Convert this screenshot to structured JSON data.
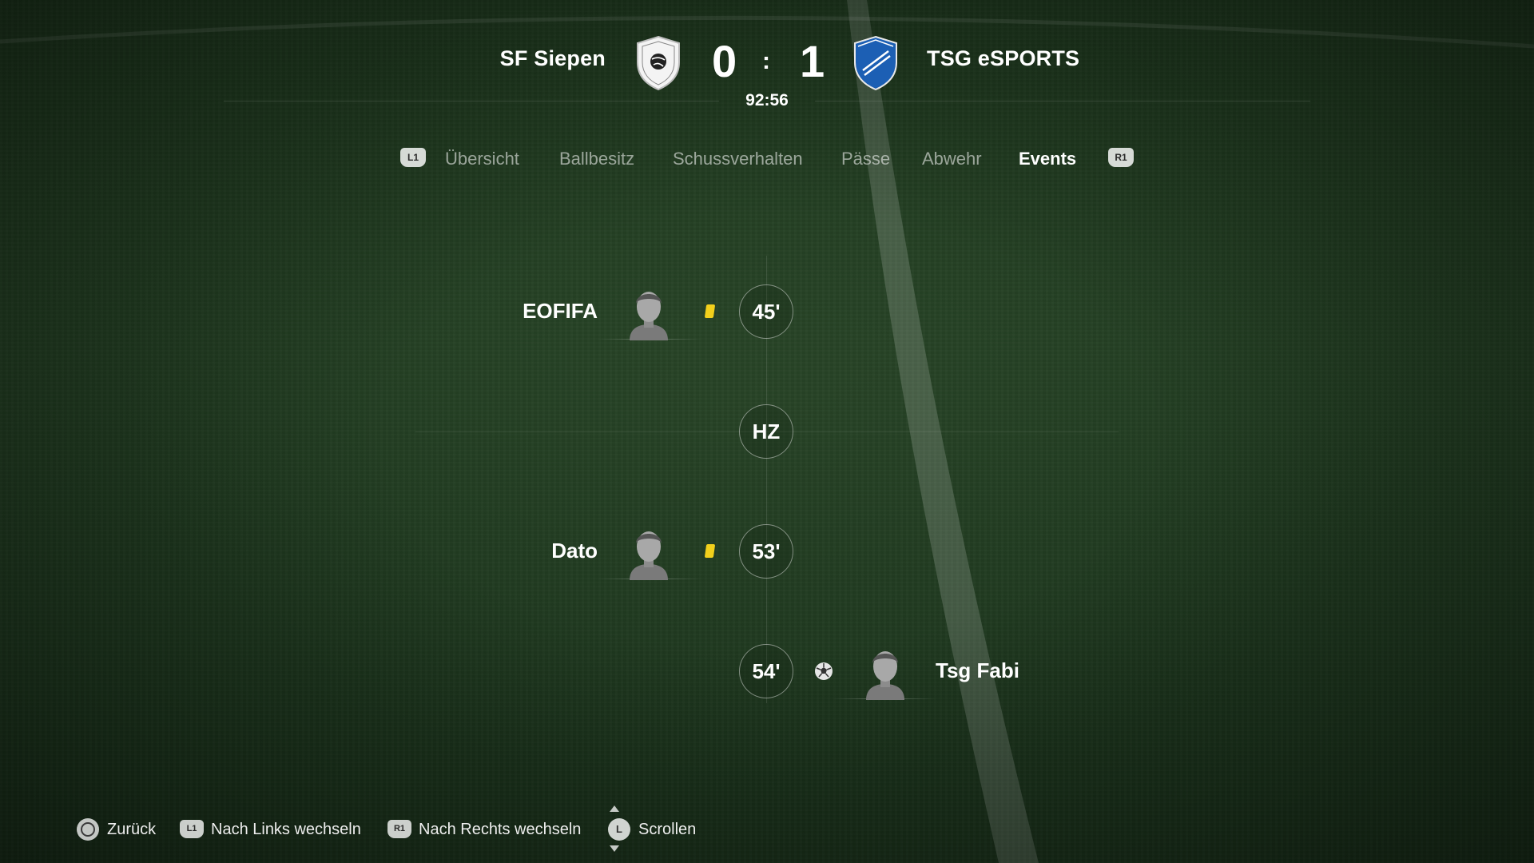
{
  "match": {
    "home_team": "SF Siepen",
    "away_team": "TSG eSPORTS",
    "home_score": "0",
    "away_score": "1",
    "separator": ":",
    "clock": "92:56"
  },
  "tabs": {
    "left_button": "L1",
    "right_button": "R1",
    "items": [
      "Übersicht",
      "Ballbesitz",
      "Schussverhalten",
      "Pässe",
      "Abwehr",
      "Events"
    ],
    "active": "Events"
  },
  "events": [
    {
      "minute": "45'",
      "side": "home",
      "player": "EOFIFA",
      "type": "yellow-card"
    },
    {
      "minute": "HZ",
      "side": "none",
      "player": "",
      "type": "half-time"
    },
    {
      "minute": "53'",
      "side": "home",
      "player": "Dato",
      "type": "yellow-card"
    },
    {
      "minute": "54'",
      "side": "away",
      "player": "Tsg Fabi",
      "type": "goal"
    }
  ],
  "footer": {
    "back": {
      "button": "circle",
      "label": "Zurück"
    },
    "prev": {
      "button": "L1",
      "label": "Nach Links wechseln"
    },
    "next": {
      "button": "R1",
      "label": "Nach Rechts wechseln"
    },
    "scroll": {
      "button": "L",
      "label": "Scrollen"
    }
  },
  "colors": {
    "yellow_card": "#f2d01c",
    "away_crest_blue": "#1c5fb4",
    "active_tab": "#ffffff",
    "inactive_tab": "rgba(255,255,255,0.55)"
  }
}
